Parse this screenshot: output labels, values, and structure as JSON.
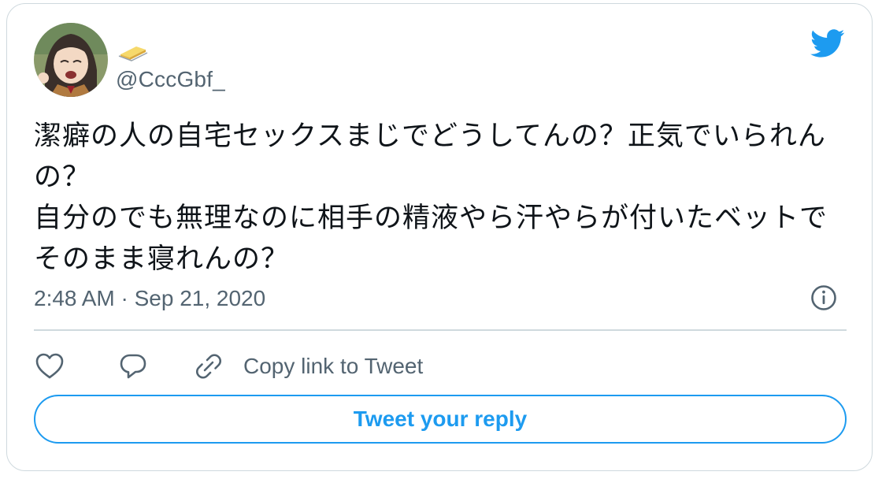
{
  "tweet": {
    "handle": "@CccGbf_",
    "text": "潔癖の人の自宅セックスまじでどうしてんの？正気でいられんの？\n自分のでも無理なのに相手の精液やら汗やらが付いたベットでそのまま寝れんの？",
    "timestamp": "2:48 AM · Sep 21, 2020"
  },
  "actions": {
    "copy_link_label": "Copy link to Tweet",
    "reply_label": "Tweet your reply"
  },
  "colors": {
    "accent": "#1d9bf0",
    "secondary_text": "#536471",
    "border": "#cfd9de"
  },
  "icons": [
    "avatar",
    "butter-emoji-icon",
    "twitter-bird-icon",
    "info-icon",
    "heart-icon",
    "reply-icon",
    "link-icon"
  ]
}
